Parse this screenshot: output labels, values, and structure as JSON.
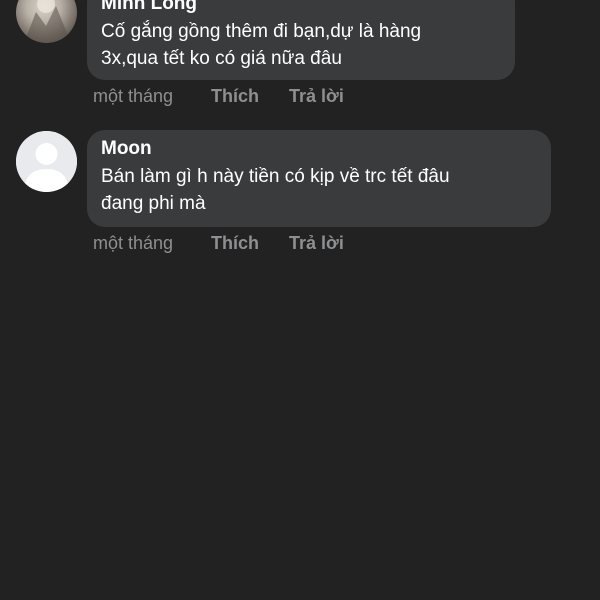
{
  "comments": [
    {
      "author": "Minh Long",
      "text": "Cố gắng gồng thêm đi bạn,dự là hàng\n3x,qua tết ko có giá nữa đâu",
      "time": "một tháng",
      "like_label": "Thích",
      "reply_label": "Trả lời",
      "avatar": "photo"
    },
    {
      "author": "Moon",
      "text": "Bán làm gì h này tiền có kịp về trc tết đâu\nđang phi mà",
      "time": "một tháng",
      "like_label": "Thích",
      "reply_label": "Trả lời",
      "avatar": "default-profile-icon"
    }
  ],
  "colors": {
    "background": "#222222",
    "bubble": "#3a3b3c",
    "text": "#ffffff",
    "meta": "#8e8f91"
  }
}
